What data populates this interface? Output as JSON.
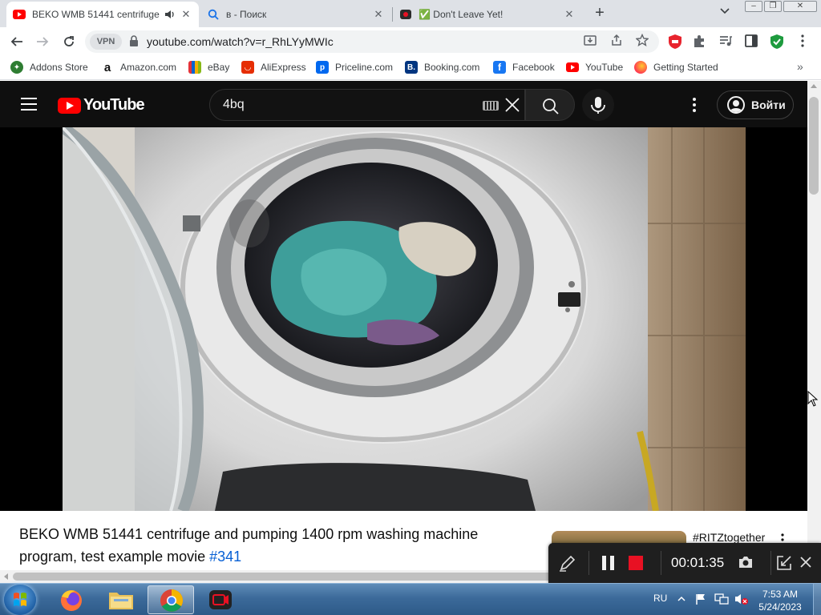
{
  "browser": {
    "tabs": [
      {
        "title": "BEKO WMB 51441 centrifuge",
        "icon": "youtube-icon",
        "active": true
      },
      {
        "title": "в - Поиск",
        "icon": "search-icon",
        "active": false
      },
      {
        "title": "✅ Don't Leave Yet!",
        "icon": "recorder-app-icon",
        "active": false
      }
    ],
    "url": "youtube.com/watch?v=r_RhLYyMWIc",
    "vpn_label": "VPN",
    "bookmarks": [
      {
        "label": "Addons Store",
        "icon": "addons-store-icon",
        "color": "#34a853"
      },
      {
        "label": "Amazon.com",
        "icon": "amazon-icon",
        "color": "#ffffff"
      },
      {
        "label": "eBay",
        "icon": "ebay-icon",
        "color": "#f5af02"
      },
      {
        "label": "AliExpress",
        "icon": "aliexpress-icon",
        "color": "#e62e04"
      },
      {
        "label": "Priceline.com",
        "icon": "priceline-icon",
        "color": "#0068ef"
      },
      {
        "label": "Booking.com",
        "icon": "booking-icon",
        "color": "#003580"
      },
      {
        "label": "Facebook",
        "icon": "facebook-icon",
        "color": "#1877f2"
      },
      {
        "label": "YouTube",
        "icon": "youtube-icon",
        "color": "#ff0000"
      },
      {
        "label": "Getting Started",
        "icon": "firefox-icon",
        "color": "#ff7139"
      }
    ]
  },
  "youtube": {
    "search_value": "4bq",
    "signin_label": "Войти",
    "video_title": "BEKO WMB 51441 centrifuge and pumping 1400 rpm washing machine program, test example movie ",
    "video_hashtag": "#341",
    "recommended_title": "#RITZtogether"
  },
  "recorder": {
    "timer": "00:01:35"
  },
  "taskbar": {
    "language": "RU",
    "time": "7:53 AM",
    "date": "5/24/2023"
  },
  "colors": {
    "youtube_red": "#ff0000",
    "link_blue": "#065fd4",
    "record_red": "#e81123"
  }
}
